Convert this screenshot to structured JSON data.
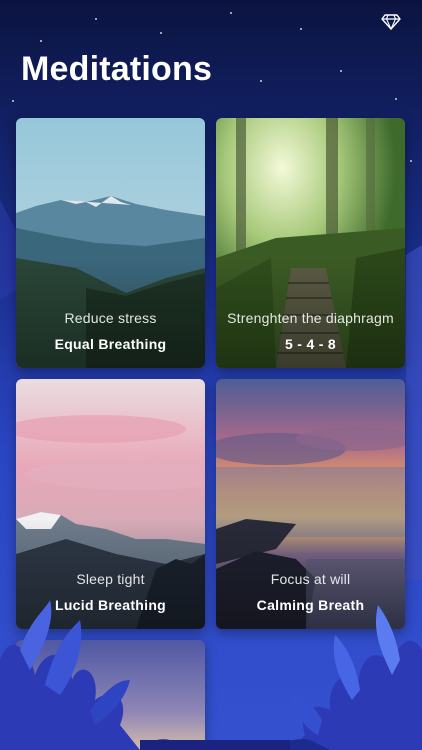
{
  "header": {
    "title": "Meditations",
    "premium_icon": "diamond-icon"
  },
  "cards": [
    {
      "subtitle": "Reduce stress",
      "name": "Equal Breathing",
      "art": "mountain-valley-image"
    },
    {
      "subtitle": "Strenghten the diaphragm",
      "name": "5 - 4 - 8",
      "art": "forest-stairs-image"
    },
    {
      "subtitle": "Sleep tight",
      "name": "Lucid Breathing",
      "art": "pink-sky-mountains-image"
    },
    {
      "subtitle": "Focus at will",
      "name": "Calming Breath",
      "art": "sunset-sea-image"
    },
    {
      "subtitle": "",
      "name": "",
      "art": "dusk-sky-image"
    }
  ],
  "colors": {
    "background_top": "#0b1440",
    "background_bottom": "#3551cf",
    "foliage": "#2a3ab8"
  }
}
